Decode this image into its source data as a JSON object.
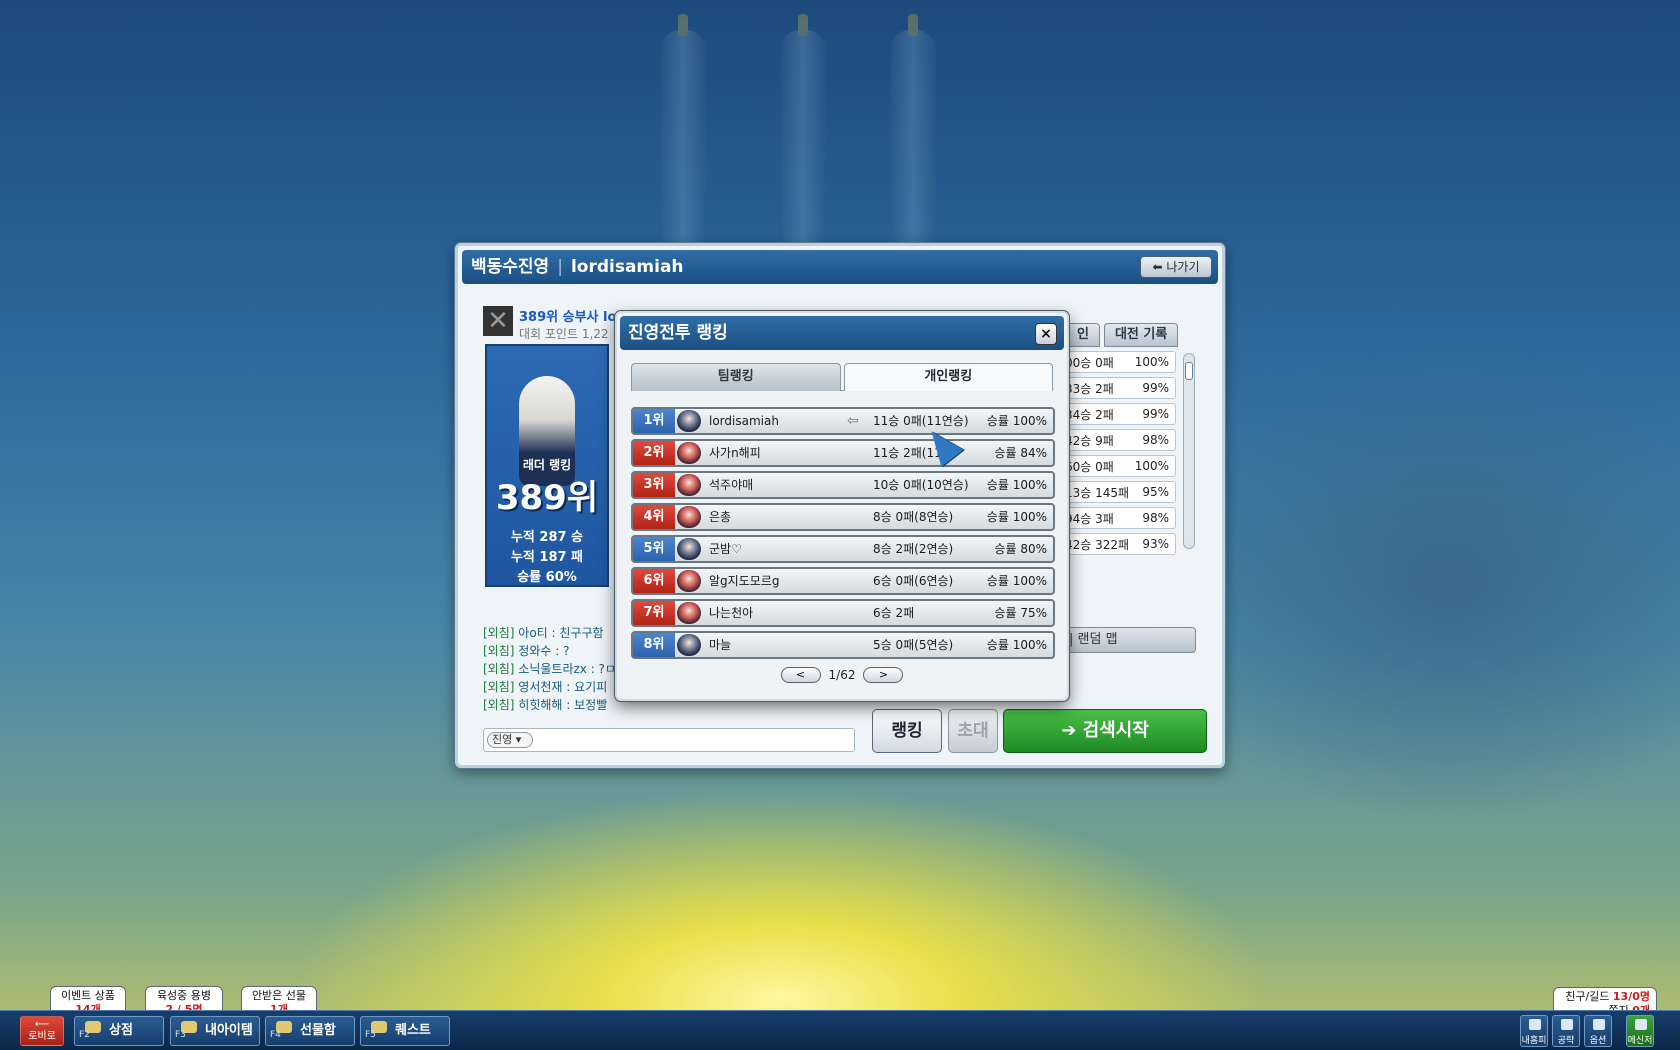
{
  "main_window": {
    "camp": "백동수진영",
    "user": "lordisamiah",
    "exit_label": "나가기",
    "rank_text": "389위 승부사 lordisamiah",
    "points_text": "대회 포인트 1,22",
    "character": {
      "ladder_label": "래더 랭킹",
      "ladder_rank": "389위",
      "wins": "누적 287 승",
      "losses": "누적 187 패",
      "win_rate": "승률 60%"
    },
    "tabs": [
      "인",
      "대전 기록"
    ],
    "stats_rows": [
      {
        "record": "00승 0패",
        "rate": "100%"
      },
      {
        "record": "33승 2패",
        "rate": "99%"
      },
      {
        "record": "34승 2패",
        "rate": "99%"
      },
      {
        "record": "42승 9패",
        "rate": "98%"
      },
      {
        "record": "60승 0패",
        "rate": "100%"
      },
      {
        "record": "13승 145패",
        "rate": "95%"
      },
      {
        "record": "94승 3패",
        "rate": "98%"
      },
      {
        "record": "42승 322패",
        "rate": "93%"
      }
    ],
    "map_label": "| 랜덤 맵",
    "chat": [
      {
        "tag": "[외침]",
        "text": "아o티 : 친구구함"
      },
      {
        "tag": "[외침]",
        "text": "정와수 : ?"
      },
      {
        "tag": "[외침]",
        "text": "소닉울트라zx : ?ㅁ"
      },
      {
        "tag": "[외침]",
        "text": "영서천재 : 요기피"
      },
      {
        "tag": "[외침]",
        "text": "히힛해해 : 보정빨"
      }
    ],
    "chat_channel": "진영",
    "buttons": {
      "ranking": "랭킹",
      "invite": "초대",
      "search": "검색시작"
    }
  },
  "ranking_popup": {
    "title": "진영전투 랭킹",
    "close_label": "×",
    "tabs": [
      "팀랭킹",
      "개인랭킹"
    ],
    "active_tab": "개인랭킹",
    "rows": [
      {
        "rank": "1위",
        "name": "lordisamiah",
        "record": "11승 0패(11연승)",
        "rate": "승률 100%",
        "badge": "blue"
      },
      {
        "rank": "2위",
        "name": "사가n해피",
        "record": "11승 2패(11",
        "rate": "승률 84%",
        "badge": "red"
      },
      {
        "rank": "3위",
        "name": "석주야매",
        "record": "10승 0패(10연승)",
        "rate": "승률 100%",
        "badge": "red"
      },
      {
        "rank": "4위",
        "name": "은총",
        "record": "8승 0패(8연승)",
        "rate": "승률 100%",
        "badge": "red"
      },
      {
        "rank": "5위",
        "name": "군밤♡",
        "record": "8승 2패(2연승)",
        "rate": "승률 80%",
        "badge": "blue"
      },
      {
        "rank": "6위",
        "name": "알g지도모르g",
        "record": "6승 0패(6연승)",
        "rate": "승률 100%",
        "badge": "red"
      },
      {
        "rank": "7위",
        "name": "나는천아",
        "record": "6승 2패",
        "rate": "승률 75%",
        "badge": "red"
      },
      {
        "rank": "8위",
        "name": "마늘",
        "record": "5승 0패(5연승)",
        "rate": "승률 100%",
        "badge": "blue"
      }
    ],
    "pager": {
      "prev": "<",
      "page": "1/62",
      "next": ">"
    }
  },
  "taskbar": {
    "lobby": "로비로",
    "buttons": [
      {
        "key": "F2",
        "label": "상점"
      },
      {
        "key": "F3",
        "label": "내아이템"
      },
      {
        "key": "F4",
        "label": "선물함"
      },
      {
        "key": "F5",
        "label": "퀘스트"
      }
    ],
    "bubbles": [
      {
        "title": "이벤트 상품",
        "value": "14개"
      },
      {
        "title": "육성중 용병",
        "value": "2 / 5명"
      },
      {
        "title": "안받은 선물",
        "value": "1개"
      }
    ],
    "friends": {
      "label": "친구/길드",
      "count": "13/0명",
      "notes_label": "쪽지",
      "notes": "0개"
    },
    "right_buttons": [
      "내홈피",
      "공략",
      "옵션",
      "메신저"
    ]
  }
}
